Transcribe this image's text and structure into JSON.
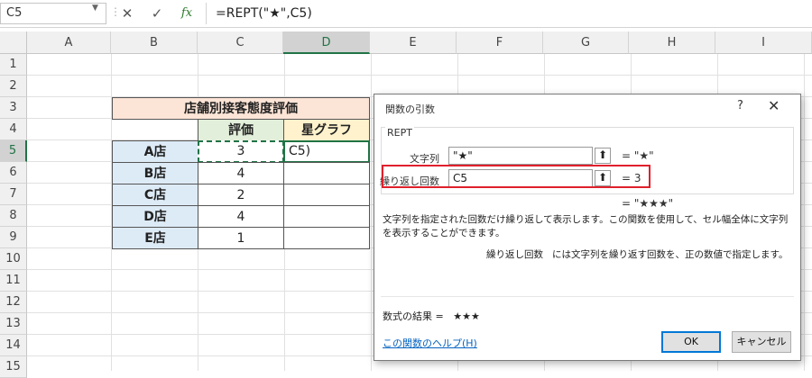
{
  "formula_bar": {
    "name_box": "C5",
    "cancel_glyph": "✕",
    "enter_glyph": "✓",
    "fx_label": "fx",
    "formula": "=REPT(\"★\",C5)"
  },
  "columns": [
    "A",
    "B",
    "C",
    "D",
    "E",
    "F",
    "G",
    "H",
    "I"
  ],
  "selected_column": "D",
  "rows": [
    "1",
    "2",
    "3",
    "4",
    "5",
    "6",
    "7",
    "8",
    "9",
    "10",
    "11",
    "12",
    "13",
    "14",
    "15"
  ],
  "selected_row": "5",
  "table": {
    "title": "店舗別接客態度評価",
    "header_rating": "評価",
    "header_graph": "星グラフ",
    "stores": [
      {
        "name": "A店",
        "rating": "3"
      },
      {
        "name": "B店",
        "rating": "4"
      },
      {
        "name": "C店",
        "rating": "2"
      },
      {
        "name": "D店",
        "rating": "4"
      },
      {
        "name": "E店",
        "rating": "1"
      }
    ],
    "active_cell_text": "C5)"
  },
  "dialog": {
    "title": "関数の引数",
    "help_glyph": "?",
    "close_glyph": "✕",
    "function_name": "REPT",
    "arg1_label": "文字列",
    "arg1_value": "\"★\"",
    "arg1_result": "=  \"★\"",
    "arg2_label": "繰り返し回数",
    "arg2_value": "C5",
    "arg2_result": "=  3",
    "formula_result_preview": "=  \"★★★\"",
    "description": "文字列を指定された回数だけ繰り返して表示します。この関数を使用して、セル幅全体に文字列を表示することができます。",
    "arg_description_name": "繰り返し回数",
    "arg_description_text": "には文字列を繰り返す回数を、正の数値で指定します。",
    "result_label": "数式の結果 =",
    "result_value": "★★★",
    "help_link": "この関数のヘルプ(H)",
    "ok_label": "OK",
    "cancel_label": "キャンセル"
  },
  "colors": {
    "title_fill": "#fce4d6",
    "rating_header_fill": "#e2efda",
    "graph_header_fill": "#fff2cc",
    "store_fill": "#ddebf7",
    "excel_green": "#217346",
    "highlight_red": "#e0202c"
  }
}
